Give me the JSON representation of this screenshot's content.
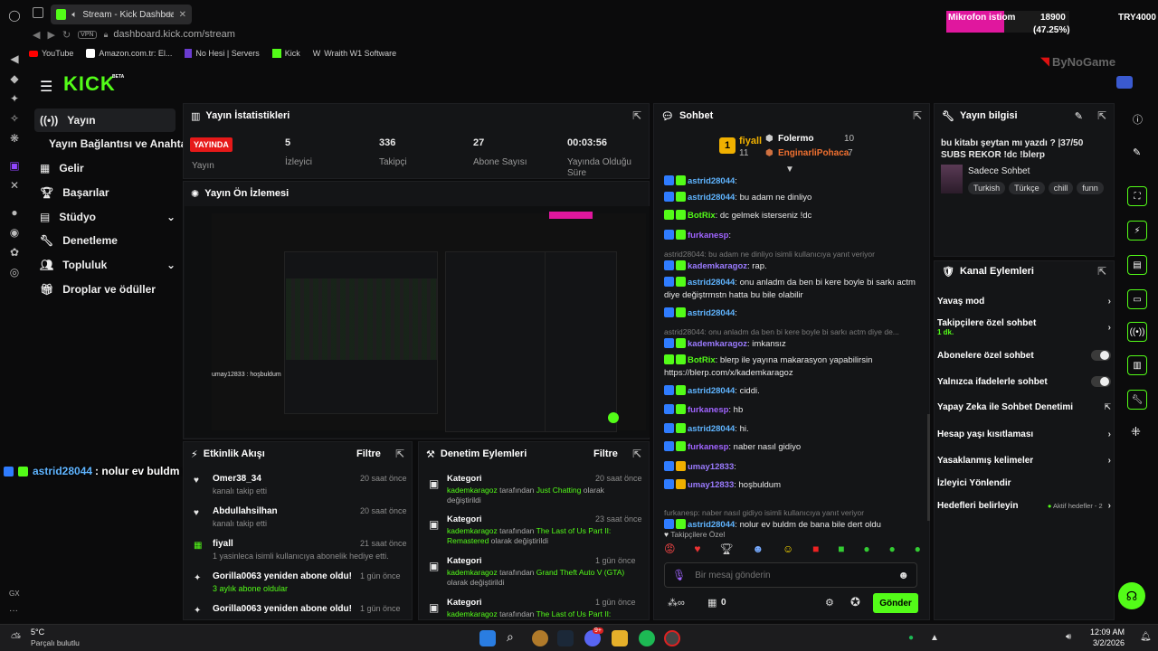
{
  "browser": {
    "tab_title": "Stream - Kick Dashboar",
    "address": "dashboard.kick.com/stream",
    "vpn": "VPN",
    "bookmarks": [
      "YouTube",
      "Amazon.com.tr: El...",
      "No Hesi | Servers",
      "Kick",
      "Wraith W1 Software"
    ],
    "gx_label": "GX"
  },
  "overlay": {
    "mic_label": "Mikrofon istiom",
    "mic_value": "18900",
    "mic_pct": "(47.25%)",
    "mic_fill": 0.4725,
    "try_label": "TRY4000",
    "logo_text": "ByNoGame",
    "chat_overlay_user": "astrid28044",
    "chat_overlay_msg": ": nolur ev buldm de bana bile dert oldu"
  },
  "header": {
    "logo": "KICK",
    "beta": "BETA"
  },
  "nav": {
    "items": [
      "Yayın",
      "Yayın Bağlantısı ve Anahtarı",
      "Gelir",
      "Başarılar",
      "Stüdyo",
      "Denetleme",
      "Topluluk",
      "Droplar ve ödüller"
    ]
  },
  "stats": {
    "title": "Yayın İstatistikleri",
    "live_badge": "YAYINDA",
    "items": [
      {
        "value": "",
        "label": "Yayın"
      },
      {
        "value": "5",
        "label": "İzleyici"
      },
      {
        "value": "336",
        "label": "Takipçi"
      },
      {
        "value": "27",
        "label": "Abone Sayısı"
      },
      {
        "value": "00:03:56",
        "label": "Yayında Olduğu Süre"
      }
    ]
  },
  "preview": {
    "title": "Yayın Ön İzlemesi",
    "preview_chat": "umay12833 : hoşbuldum"
  },
  "activity": {
    "title": "Etkinlik Akışı",
    "filter": "Filtre",
    "items": [
      {
        "name": "Omer38_34",
        "time": "20 saat önce",
        "desc": "kanalı takip etti"
      },
      {
        "name": "Abdullahsilhan",
        "time": "20 saat önce",
        "desc": "kanalı takip etti"
      },
      {
        "name": "fiyall",
        "time": "21 saat önce",
        "desc": "1 yasinleca isimli kullanıcıya abonelik hediye etti."
      },
      {
        "name": "Gorilla0063 yeniden abone oldu!",
        "time": "1 gün önce",
        "desc": "3 aylık abone oldular"
      },
      {
        "name": "Gorilla0063 yeniden abone oldu!",
        "time": "1 gün önce",
        "desc": ""
      }
    ]
  },
  "moderation": {
    "title": "Denetim Eylemleri",
    "filter": "Filtre",
    "items": [
      {
        "name": "Kategori",
        "time": "20 saat önce",
        "user": "kademkaragoz",
        "mid": " tarafından ",
        "game": "Just Chatting",
        "end": " olarak değiştirildi"
      },
      {
        "name": "Kategori",
        "time": "23 saat önce",
        "user": "kademkaragoz",
        "mid": " tarafından ",
        "game": "The Last of Us Part II: Remastered",
        "end": " olarak değiştirildi"
      },
      {
        "name": "Kategori",
        "time": "1 gün önce",
        "user": "kademkaragoz",
        "mid": " tarafından ",
        "game": "Grand Theft Auto V (GTA)",
        "end": " olarak değiştirildi"
      },
      {
        "name": "Kategori",
        "time": "1 gün önce",
        "user": "kademkaragoz",
        "mid": " tarafından ",
        "game": "The Last of Us Part II:",
        "end": ""
      }
    ]
  },
  "chat": {
    "title": "Sohbet",
    "top": [
      {
        "rank": "1",
        "name": "fiyall",
        "count": "11"
      },
      {
        "name": "Folermo",
        "count": "10"
      },
      {
        "name": "EnginarliPohaca",
        "count": "7"
      }
    ],
    "messages": [
      {
        "user": "astrid28044",
        "text": ":",
        "reply": ""
      },
      {
        "user": "astrid28044",
        "text": ": bu adam ne dinliyo",
        "reply": ""
      },
      {
        "user": "BotRix",
        "text": ": dc gelmek isterseniz !dc",
        "reply": ""
      },
      {
        "user": "furkanesp",
        "text": ":",
        "reply": ""
      },
      {
        "user": "kademkaragoz",
        "text": ": rap.",
        "reply": "astrid28044: bu adam ne dinliyo isimli kullanıcıya yanıt veriyor"
      },
      {
        "user": "astrid28044",
        "text": ": onu anladm da ben bi kere boyle bi sarkı actm diye değiştrmstn hatta bu bile olabilir",
        "reply": ""
      },
      {
        "user": "astrid28044",
        "text": ":",
        "reply": ""
      },
      {
        "user": "kademkaragoz",
        "text": ": imkansız",
        "reply": "astrid28044: onu anladm da ben bi kere boyle bi sarkı actm diye de..."
      },
      {
        "user": "BotRix",
        "text": ": blerp ile yayına makarasyon yapabilirsin https://blerp.com/x/kademkaragoz",
        "reply": ""
      },
      {
        "user": "astrid28044",
        "text": ": ciddi.",
        "reply": ""
      },
      {
        "user": "furkanesp",
        "text": ": hb",
        "reply": ""
      },
      {
        "user": "astrid28044",
        "text": ": hi.",
        "reply": ""
      },
      {
        "user": "furkanesp",
        "text": ": naber nasıl gidiyo",
        "reply": ""
      },
      {
        "user": "umay12833",
        "text": ":",
        "reply": ""
      },
      {
        "user": "umay12833",
        "text": ": hoşbuldum",
        "reply": ""
      },
      {
        "user": "astrid28044",
        "text": ": nolur ev buldm de bana bile dert oldu",
        "reply": "furkanesp: naber nasıl gidiyo isimli kullanıcıya yanıt veriyor"
      }
    ],
    "followers_only": "Takipçilere Özel",
    "input_placeholder": "Bir mesaj gönderin",
    "points": "0",
    "send": "Gönder"
  },
  "info": {
    "title": "Yayın bilgisi",
    "stream_title": "bu kitabı şeytan mı yazdı ? |37/50 SUBS REKOR !dc !blerp",
    "category": "Sadece Sohbet",
    "tags": [
      "Turkish",
      "Türkçe",
      "chill",
      "funn"
    ]
  },
  "channel_actions": {
    "title": "Kanal Eylemleri",
    "items": [
      {
        "label": "Yavaş mod",
        "sub": "",
        "ctrl": "chevron"
      },
      {
        "label": "Takipçilere özel sohbet",
        "sub": "1 dk.",
        "ctrl": "chevron"
      },
      {
        "label": "Abonelere özel sohbet",
        "sub": "",
        "ctrl": "toggle"
      },
      {
        "label": "Yalnızca ifadelerle sohbet",
        "sub": "",
        "ctrl": "toggle"
      },
      {
        "label": "Yapay Zeka ile Sohbet Denetimi",
        "sub": "",
        "ctrl": "ext"
      },
      {
        "label": "Hesap yaşı kısıtlaması",
        "sub": "",
        "ctrl": "chevron"
      },
      {
        "label": "Yasaklanmış kelimeler",
        "sub": "",
        "ctrl": "chevron"
      },
      {
        "label": "İzleyici Yönlendir",
        "sub": "",
        "ctrl": ""
      },
      {
        "label": "Hedefleri belirleyin",
        "sub": "Aktif hedefler - 2",
        "ctrl": "chevron"
      }
    ]
  },
  "taskbar": {
    "weather_temp": "5°C",
    "weather_desc": "Parçalı bulutlu",
    "time": "12:09 AM",
    "date": "3/2/2026",
    "notif_count": "9+"
  },
  "colors": {
    "accent": "#53fc18",
    "live": "#e61919",
    "mic_bar": "#e0179e"
  }
}
